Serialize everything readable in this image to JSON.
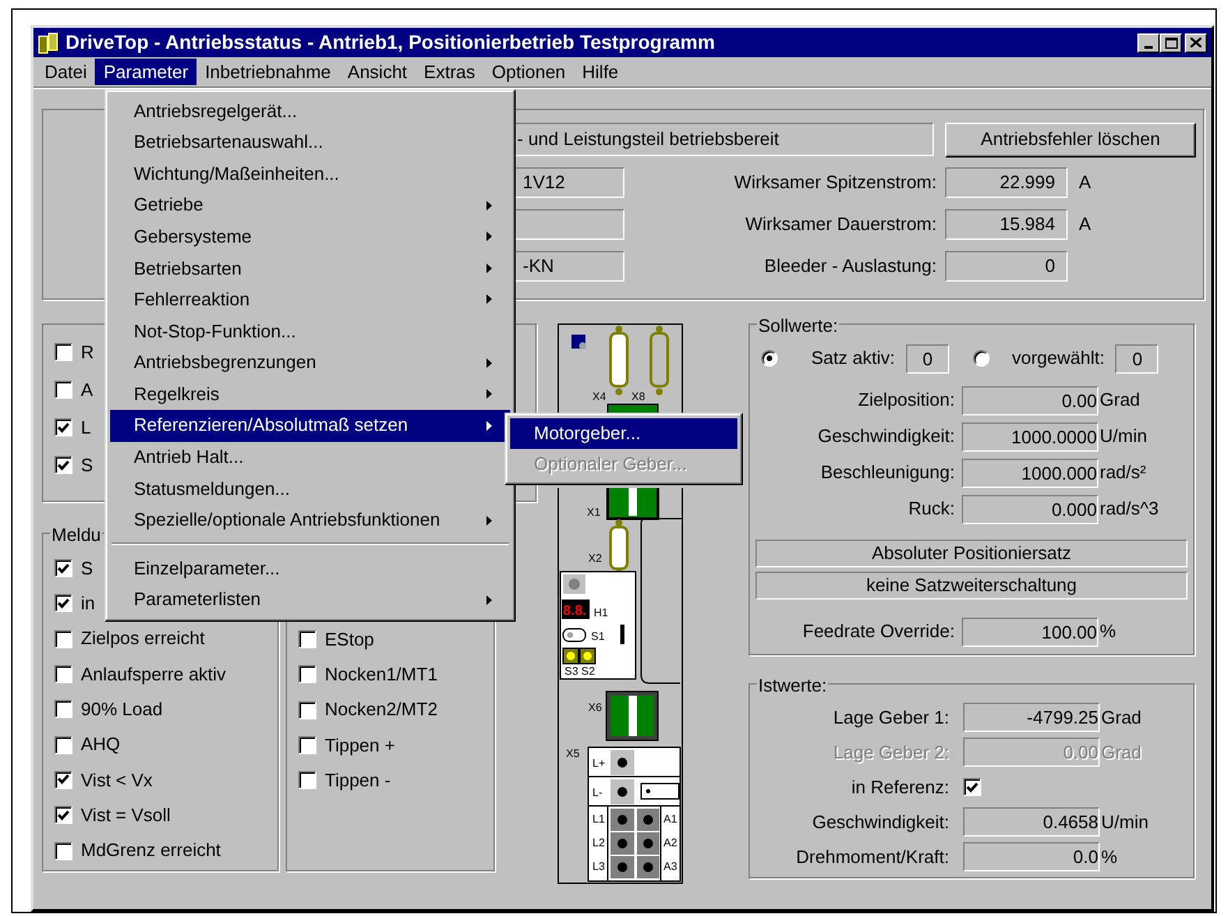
{
  "window": {
    "title": "DriveTop - Antriebsstatus - Antrieb1, Positionierbetrieb Testprogramm"
  },
  "menubar": [
    {
      "label": "Datei",
      "selected": false
    },
    {
      "label": "Parameter",
      "selected": true
    },
    {
      "label": "Inbetriebnahme",
      "selected": false
    },
    {
      "label": "Ansicht",
      "selected": false
    },
    {
      "label": "Extras",
      "selected": false
    },
    {
      "label": "Optionen",
      "selected": false
    },
    {
      "label": "Hilfe",
      "selected": false
    }
  ],
  "parameter_menu": {
    "items": [
      {
        "kind": "item",
        "label": "Antriebsregelgerät...",
        "submenu": false,
        "selected": false
      },
      {
        "kind": "item",
        "label": "Betriebsartenauswahl...",
        "submenu": false,
        "selected": false
      },
      {
        "kind": "item",
        "label": "Wichtung/Maßeinheiten...",
        "submenu": false,
        "selected": false
      },
      {
        "kind": "item",
        "label": "Getriebe",
        "submenu": true,
        "selected": false
      },
      {
        "kind": "item",
        "label": "Gebersysteme",
        "submenu": true,
        "selected": false
      },
      {
        "kind": "item",
        "label": "Betriebsarten",
        "submenu": true,
        "selected": false
      },
      {
        "kind": "item",
        "label": "Fehlerreaktion",
        "submenu": true,
        "selected": false
      },
      {
        "kind": "item",
        "label": "Not-Stop-Funktion...",
        "submenu": false,
        "selected": false
      },
      {
        "kind": "item",
        "label": "Antriebsbegrenzungen",
        "submenu": true,
        "selected": false
      },
      {
        "kind": "item",
        "label": "Regelkreis",
        "submenu": true,
        "selected": false
      },
      {
        "kind": "item",
        "label": "Referenzieren/Absolutmaß setzen",
        "submenu": true,
        "selected": true
      },
      {
        "kind": "item",
        "label": "Antrieb Halt...",
        "submenu": false,
        "selected": false
      },
      {
        "kind": "item",
        "label": "Statusmeldungen...",
        "submenu": false,
        "selected": false
      },
      {
        "kind": "item",
        "label": "Spezielle/optionale Antriebsfunktionen",
        "submenu": true,
        "selected": false
      },
      {
        "kind": "separator"
      },
      {
        "kind": "item",
        "label": "Einzelparameter...",
        "submenu": false,
        "selected": false
      },
      {
        "kind": "item",
        "label": "Parameterlisten",
        "submenu": true,
        "selected": false
      }
    ]
  },
  "submenu": {
    "items": [
      {
        "label": "Motorgeber...",
        "selected": true,
        "disabled": false
      },
      {
        "label": "Optionaler Geber...",
        "selected": false,
        "disabled": true
      }
    ]
  },
  "status": {
    "message": "- und Leistungsteil betriebsbereit",
    "button": "Antriebsfehler löschen",
    "rows": [
      {
        "field": "1V12",
        "label": "Wirksamer Spitzenstrom:",
        "value": "22.999",
        "unit": "A"
      },
      {
        "label": "Wirksamer Dauerstrom:",
        "value": "15.984",
        "unit": "A"
      },
      {
        "field": "-KN",
        "label": "Bleeder - Auslastung:",
        "value": "0"
      }
    ]
  },
  "flags": {
    "items": [
      {
        "label": "R",
        "checked": false
      },
      {
        "label": "A",
        "checked": false
      },
      {
        "label": "L",
        "checked": true
      },
      {
        "label": "S",
        "checked": true
      }
    ]
  },
  "meldungen": {
    "title": "Meldu",
    "items": [
      {
        "label": "S",
        "checked": true
      },
      {
        "label": "in",
        "checked": true
      },
      {
        "label": "Zielpos erreicht",
        "checked": false
      },
      {
        "label": "Anlaufsperre aktiv",
        "checked": false
      },
      {
        "label": "90% Load",
        "checked": false
      },
      {
        "label": "AHQ",
        "checked": false
      },
      {
        "label": "Vist < Vx",
        "checked": true
      },
      {
        "label": "Vist = Vsoll",
        "checked": true
      },
      {
        "label": "MdGrenz erreicht",
        "checked": false
      }
    ]
  },
  "meldungen_2": {
    "items": [
      {
        "label": "EStop",
        "checked": false
      },
      {
        "label": "Nocken1/MT1",
        "checked": false
      },
      {
        "label": "Nocken2/MT2",
        "checked": false
      },
      {
        "label": "Tippen +",
        "checked": false
      },
      {
        "label": "Tippen -",
        "checked": false
      }
    ]
  },
  "device": {
    "labels": [
      "X4",
      "X8",
      "X1",
      "X2",
      "8.8.",
      "H1",
      "S1",
      "S3",
      "S2",
      "X6",
      "X5",
      "L+",
      "L-",
      "L1",
      "L2",
      "L3",
      "A1",
      "A2",
      "A3"
    ]
  },
  "sollwerte": {
    "title": "Sollwerte:",
    "modes": [
      {
        "label": "Satz aktiv:",
        "selected": true,
        "value": "0"
      },
      {
        "label": "vorgewählt:",
        "selected": false,
        "value": "0"
      }
    ],
    "rows": [
      {
        "label": "Zielposition:",
        "value": "0.00",
        "unit": "Grad"
      },
      {
        "label": "Geschwindigkeit:",
        "value": "1000.0000",
        "unit": "U/min"
      },
      {
        "label": "Beschleunigung:",
        "value": "1000.000",
        "unit": "rad/s²"
      },
      {
        "label": "Ruck:",
        "value": "0.000",
        "unit": "rad/s^3"
      }
    ],
    "info": [
      "Absoluter Positioniersatz",
      "keine Satzweiterschaltung"
    ],
    "override": {
      "label": "Feedrate Override:",
      "value": "100.00",
      "unit": "%"
    }
  },
  "istwerte": {
    "title": "Istwerte:",
    "rows": [
      {
        "kind": "value",
        "label": "Lage Geber 1:",
        "value": "-4799.25",
        "unit": "Grad",
        "disabled": false
      },
      {
        "kind": "value",
        "label": "Lage Geber 2:",
        "value": "0.00",
        "unit": "Grad",
        "disabled": true
      },
      {
        "kind": "check",
        "label": "in Referenz:",
        "checked": true
      },
      {
        "kind": "value",
        "label": "Geschwindigkeit:",
        "value": "0.4658",
        "unit": "U/min",
        "disabled": false
      },
      {
        "kind": "value",
        "label": "Drehmoment/Kraft:",
        "value": "0.0",
        "unit": "%",
        "disabled": false
      }
    ]
  }
}
